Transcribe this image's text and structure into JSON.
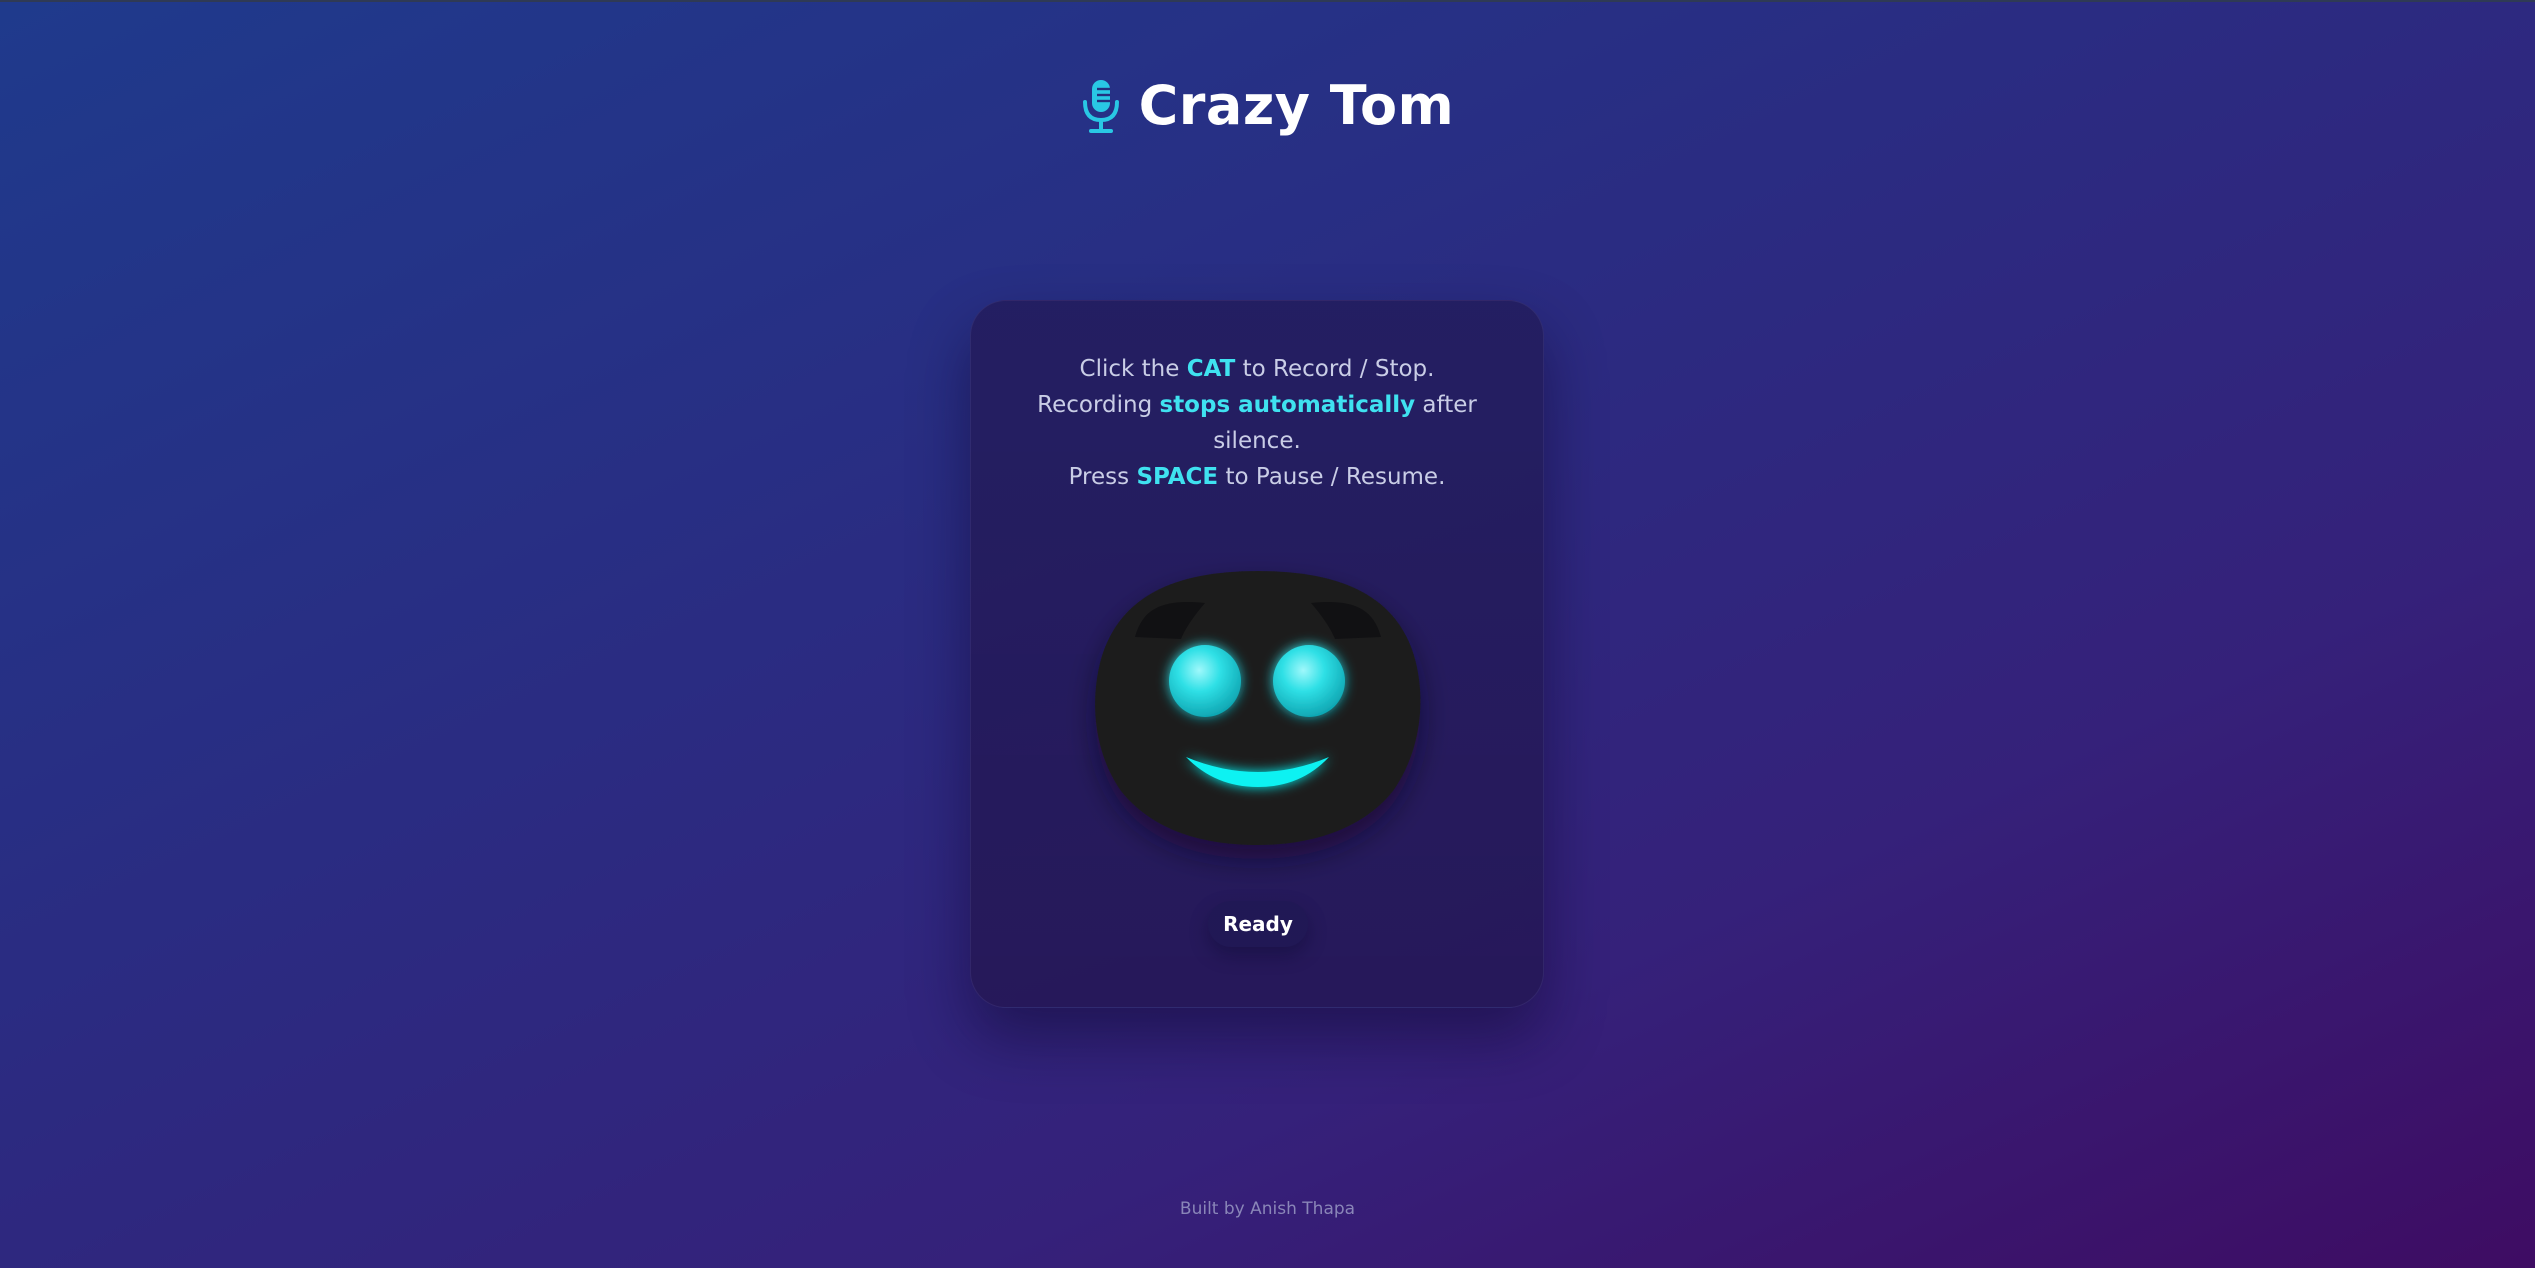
{
  "header": {
    "title": "Crazy Tom",
    "icon": "microphone-icon",
    "icon_color": "#29c8e4"
  },
  "instructions": {
    "line1_pre": "Click the ",
    "line1_hl": "CAT",
    "line1_post": " to Record / Stop.",
    "line2_pre": "Recording ",
    "line2_hl": "stops automatically",
    "line2_post": " after silence.",
    "line3_pre": "Press ",
    "line3_hl": "SPACE",
    "line3_post": " to Pause / Resume."
  },
  "cat": {
    "icon": "cat-face",
    "face_color": "#1d1d1f",
    "eye_color": "#2fe0e6",
    "mouth_color": "#10f2f2"
  },
  "status": {
    "label": "Ready"
  },
  "footer": {
    "text": "Built by Anish Thapa"
  },
  "colors": {
    "accent": "#3fe2f0",
    "background_start": "#1f3a8c",
    "background_end": "#3e0c63"
  }
}
